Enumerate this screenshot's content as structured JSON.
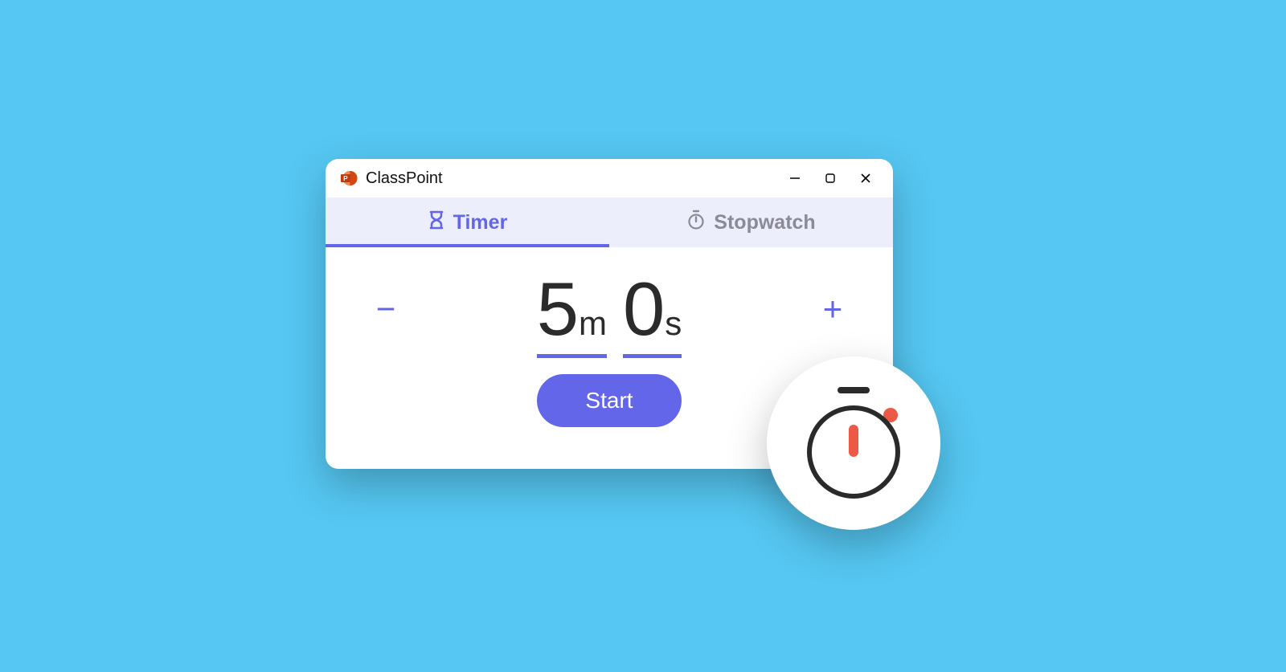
{
  "window": {
    "title": "ClassPoint"
  },
  "tabs": {
    "timer_label": "Timer",
    "stopwatch_label": "Stopwatch",
    "active": "timer"
  },
  "timer": {
    "minutes": "5",
    "minutes_unit": "m",
    "seconds": "0",
    "seconds_unit": "s",
    "decrement": "−",
    "increment": "+",
    "start_label": "Start"
  },
  "colors": {
    "background": "#55c7f2",
    "accent": "#6366e8",
    "badge_accent": "#eb5a47"
  }
}
